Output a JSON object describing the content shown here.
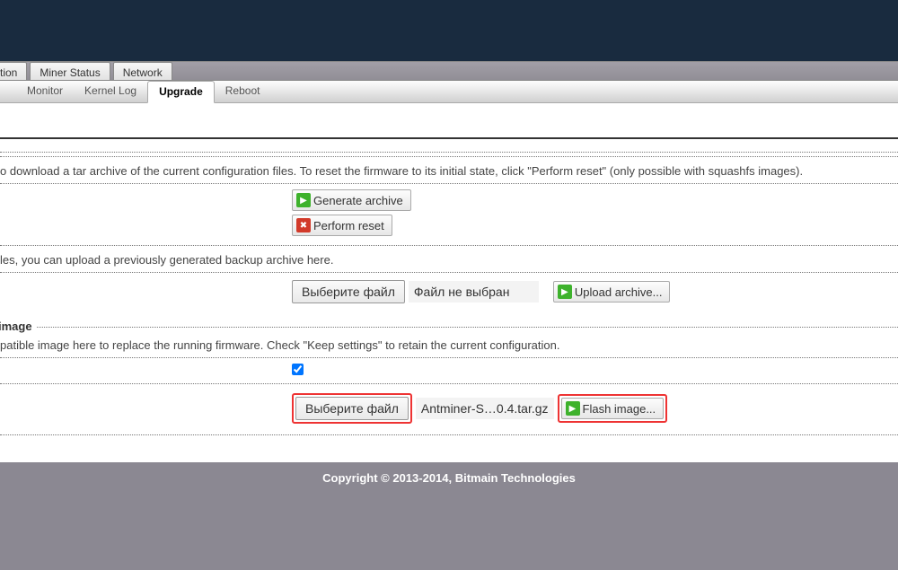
{
  "nav1": {
    "tab_cut": "tion",
    "tab_miner": "Miner Status",
    "tab_network": "Network"
  },
  "nav2": {
    "monitor": "Monitor",
    "kernel": "Kernel Log",
    "upgrade": "Upgrade",
    "reboot": "Reboot"
  },
  "backup": {
    "desc": "o download a tar archive of the current configuration files. To reset the firmware to its initial state, click \"Perform reset\" (only possible with squashfs images).",
    "generate": "Generate archive",
    "reset": "Perform reset"
  },
  "restore": {
    "desc": "les, you can upload a previously generated backup archive here.",
    "choose": "Выберите файл",
    "nofile": "Файл не выбран",
    "upload": "Upload archive..."
  },
  "flash": {
    "legend": " image",
    "desc": "patible image here to replace the running firmware. Check \"Keep settings\" to retain the current configuration.",
    "choose": "Выберите файл",
    "filename": "Antminer-S…0.4.tar.gz",
    "flash": "Flash image..."
  },
  "footer": {
    "copy": "Copyright © 2013-2014, Bitmain Technologies"
  }
}
